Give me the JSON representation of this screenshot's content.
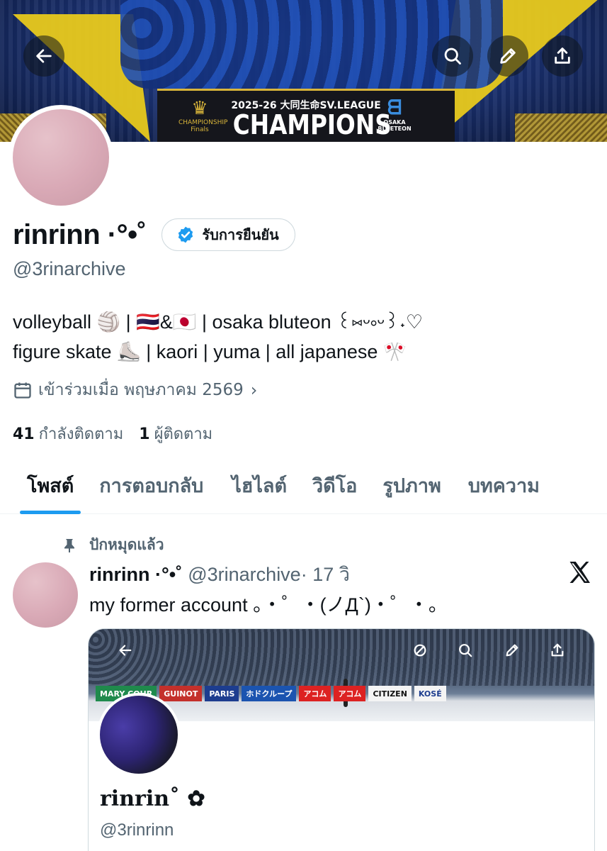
{
  "banner": {
    "board_subtitle": "2025-26 大同生命SV.LEAGUE",
    "board_title": "CHAMPIONS",
    "league_logo_text": "CHAMPIONSHIP Finals",
    "team_logo_text": "OSAKA BLUETEON"
  },
  "top_actions": [
    "back-arrow-icon",
    "search-icon",
    "edit-icon",
    "share-icon"
  ],
  "profile": {
    "display_name": "rinrinn ·°•˚",
    "verify_label": "รับการยืนยัน",
    "handle": "@3rinarchive",
    "bio_line1": "volleyball 🏐 | 🇹🇭&🇯🇵 | osaka bluteon ꒰⑅ᵕ༚ᵕ꒱˖♡",
    "bio_line2": "figure skate ⛸️ | kaori | yuma | all japanese 🎌",
    "joined": "เข้าร่วมเมื่อ พฤษภาคม 2569",
    "following_count": "41",
    "following_label": "กำลังติดตาม",
    "followers_count": "1",
    "followers_label": "ผู้ติดตาม"
  },
  "tabs": [
    {
      "label": "โพสต์",
      "active": true
    },
    {
      "label": "การตอบกลับ",
      "active": false
    },
    {
      "label": "ไฮไลต์",
      "active": false
    },
    {
      "label": "วิดีโอ",
      "active": false
    },
    {
      "label": "รูปภาพ",
      "active": false
    },
    {
      "label": "บทความ",
      "active": false
    }
  ],
  "post": {
    "pinned_label": "ปักหมุดแล้ว",
    "author_name": "rinrinn ·°•˚",
    "author_handle": "@3rinarchive",
    "time": "· 17 วิ",
    "text": "my former account 。・゜・(ノД`)・゜・。",
    "card": {
      "name": "rinrin˚ ✿",
      "handle": "@3rinrinn",
      "boards": [
        "MARY COHR",
        "GUINOT",
        "PARIS",
        "ホドクループ",
        "アコム",
        "アコム",
        "CITIZEN",
        "KOSÉ"
      ]
    }
  },
  "colors": {
    "accent": "#1d9bf0",
    "text_primary": "#0f1419",
    "text_secondary": "#536471",
    "border": "#cfd9de"
  }
}
